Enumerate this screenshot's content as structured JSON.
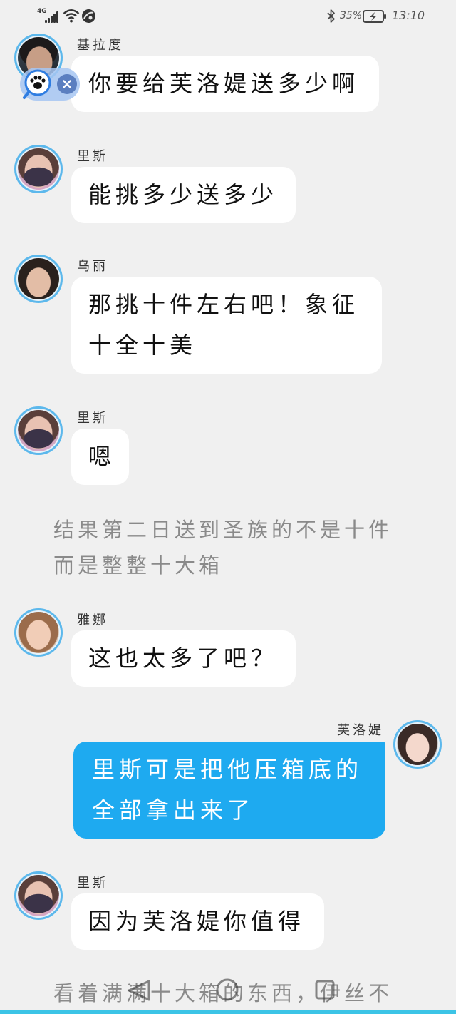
{
  "status_bar": {
    "network_type": "4G",
    "battery_percent": "35%",
    "time": "13:10",
    "left_icons": [
      "signal-icon",
      "wifi-icon",
      "app-notification-icon"
    ],
    "right_icons": [
      "bluetooth-icon",
      "battery-charging-icon"
    ]
  },
  "floating_widget": {
    "icons": [
      "paw-magnifier-icon",
      "close-icon"
    ]
  },
  "colors": {
    "page_background": "#f0f0f0",
    "bubble_background": "#ffffff",
    "self_bubble_background": "#1eaaf0",
    "self_bubble_text": "#ffffff",
    "avatar_ring": "#5cb8ec",
    "narration_text": "#8a8a8a",
    "message_text": "#111111"
  },
  "messages": [
    {
      "speaker": "基拉度",
      "side": "left",
      "lines": [
        "你要给芙洛媞送多少啊"
      ]
    },
    {
      "speaker": "里斯",
      "side": "left",
      "lines": [
        "能挑多少送多少"
      ]
    },
    {
      "speaker": "乌丽",
      "side": "left",
      "lines": [
        "那挑十件左右吧！象征",
        "十全十美"
      ]
    },
    {
      "speaker": "里斯",
      "side": "left",
      "lines": [
        "嗯"
      ]
    },
    {
      "speaker": "雅娜",
      "side": "left",
      "lines": [
        "这也太多了吧？"
      ]
    },
    {
      "speaker": "芙洛媞",
      "side": "right",
      "lines": [
        "里斯可是把他压箱底的",
        "全部拿出来了"
      ]
    },
    {
      "speaker": "里斯",
      "side": "left",
      "lines": [
        "因为芙洛媞你值得"
      ]
    }
  ],
  "narration": [
    {
      "lines": [
        "结果第二日送到圣族的不是十件",
        "而是整整十大箱"
      ]
    },
    {
      "lines": [
        "看着满满十大箱的东西，伊丝不"
      ]
    }
  ],
  "nav_bar": {
    "icons": [
      "back-icon",
      "home-icon",
      "recents-icon"
    ]
  }
}
